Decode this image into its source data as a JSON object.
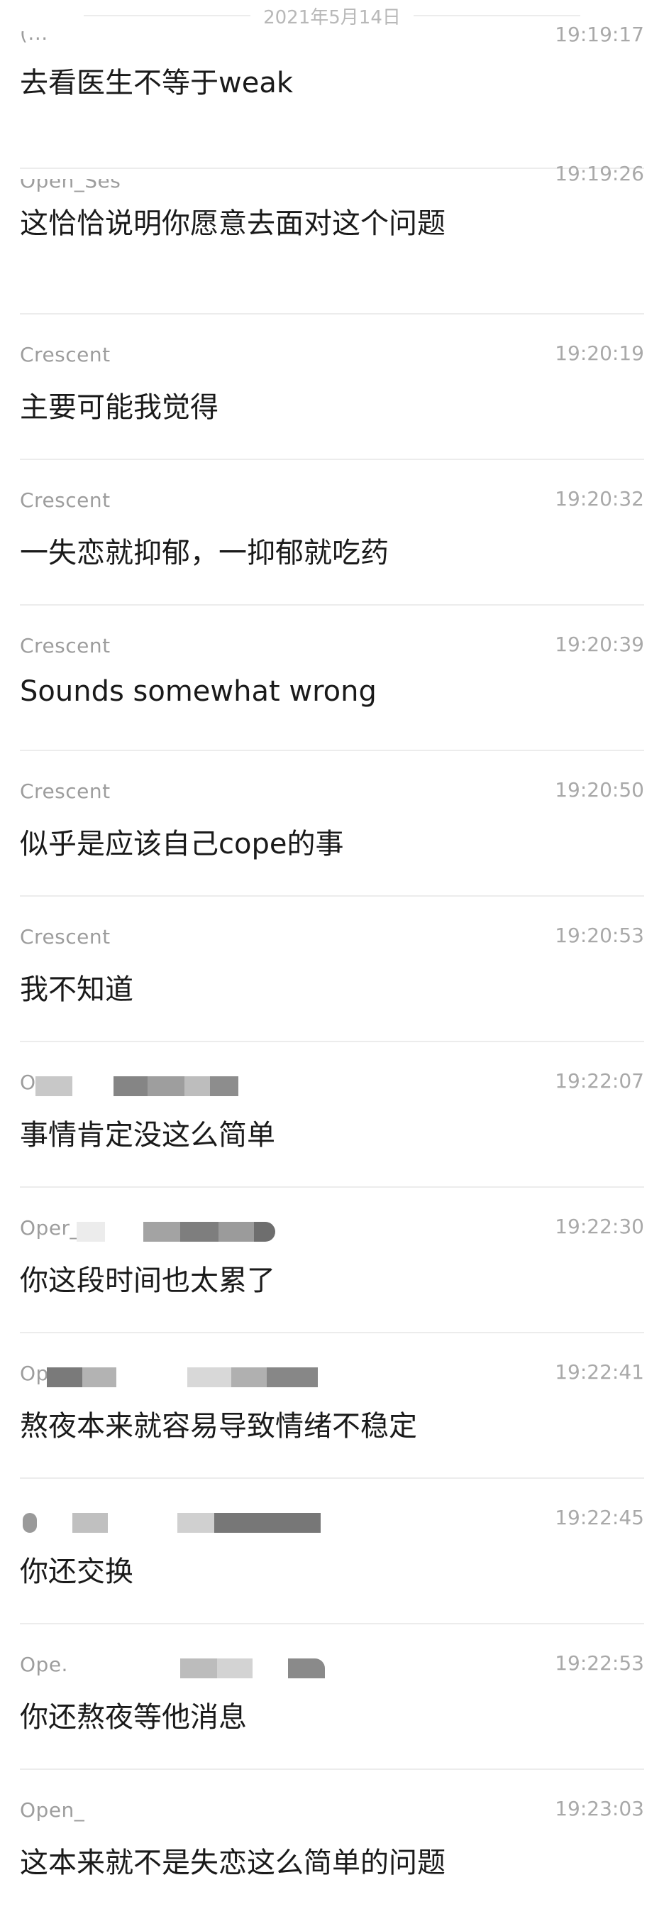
{
  "date_label": "2021年5月14日",
  "messages": [
    {
      "sender": "(...",
      "time": "19:19:17",
      "text": "去看医生不等于weak"
    },
    {
      "sender": "Open_Ses",
      "time": "19:19:26",
      "text": "这恰恰说明你愿意去面对这个问题"
    },
    {
      "sender": "Crescent",
      "time": "19:20:19",
      "text": "主要可能我觉得"
    },
    {
      "sender": "Crescent",
      "time": "19:20:32",
      "text": "一失恋就抑郁，一抑郁就吃药"
    },
    {
      "sender": "Crescent",
      "time": "19:20:39",
      "text": "Sounds somewhat wrong"
    },
    {
      "sender": "Crescent",
      "time": "19:20:50",
      "text": "似乎是应该自己cope的事"
    },
    {
      "sender": "Crescent",
      "time": "19:20:53",
      "text": "我不知道"
    },
    {
      "sender": "O",
      "time": "19:22:07",
      "text": "事情肯定没这么简单"
    },
    {
      "sender": "Oper_",
      "time": "19:22:30",
      "text": "你这段时间也太累了"
    },
    {
      "sender": "Op",
      "time": "19:22:41",
      "text": "熬夜本来就容易导致情绪不稳定"
    },
    {
      "sender": "",
      "time": "19:22:45",
      "text": "你还交换"
    },
    {
      "sender": "Ope.",
      "time": "19:22:53",
      "text": "你还熬夜等他消息"
    },
    {
      "sender": "Open_",
      "time": "19:23:03",
      "text": "这本来就不是失恋这么简单的问题"
    }
  ]
}
